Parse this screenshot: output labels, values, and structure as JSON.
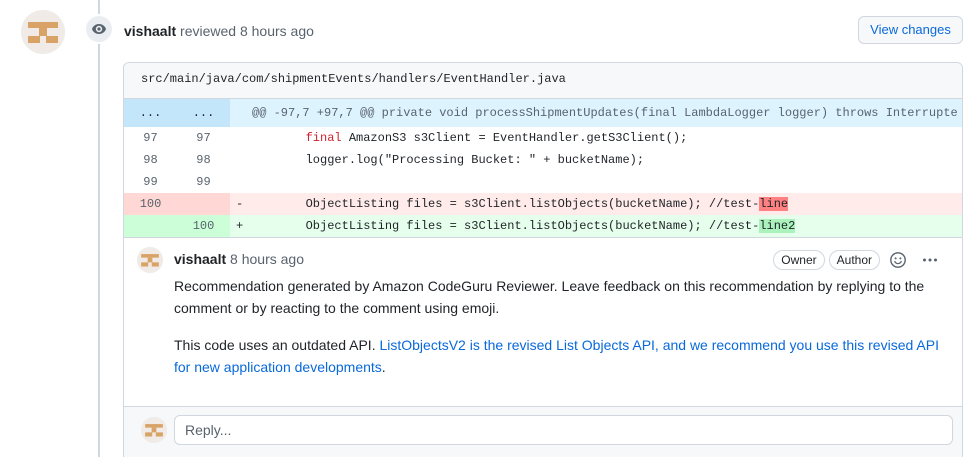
{
  "review": {
    "author": "vishaalt",
    "action": "reviewed",
    "time": "8 hours ago",
    "view_changes_label": "View changes"
  },
  "file": {
    "path": "src/main/java/com/shipmentEvents/handlers/EventHandler.java"
  },
  "diff": {
    "hunk": {
      "old_ln": "...",
      "new_ln": "...",
      "text": "@@ -97,7 +97,7 @@ private void processShipmentUpdates(final LambdaLogger logger) throws Interrupte"
    },
    "context_lines": [
      {
        "old_ln": "97",
        "new_ln": "97",
        "keyword": "final",
        "text": " AmazonS3 s3Client = EventHandler.getS3Client();"
      },
      {
        "old_ln": "98",
        "new_ln": "98",
        "keyword": "",
        "text": "logger.log(\"Processing Bucket: \" + bucketName);"
      },
      {
        "old_ln": "99",
        "new_ln": "99",
        "keyword": "",
        "text": ""
      }
    ],
    "deleted_line": {
      "old_ln": "100",
      "new_ln": "",
      "sign": "-",
      "text": "ObjectListing files = s3Client.listObjects(bucketName); //test-",
      "highlight": "line"
    },
    "added_line": {
      "old_ln": "",
      "new_ln": "100",
      "sign": "+",
      "text": "ObjectListing files = s3Client.listObjects(bucketName); //test-",
      "highlight": "line2"
    }
  },
  "comment": {
    "author": "vishaalt",
    "time": "8 hours ago",
    "labels": [
      "Owner",
      "Author"
    ],
    "paragraph1": "Recommendation generated by Amazon CodeGuru Reviewer. Leave feedback on this recommendation by replying to the comment or by reacting to the comment using emoji.",
    "paragraph2_prefix": "This code uses an outdated API. ",
    "paragraph2_link": "ListObjectsV2 is the revised List Objects API, and we recommend you use this revised API for new application developments",
    "paragraph2_suffix": "."
  },
  "reply": {
    "placeholder": "Reply..."
  },
  "icons": {
    "eye": "eye-icon",
    "smiley": "smiley-icon",
    "kebab": "kebab-horizontal-icon"
  },
  "colors": {
    "link": "#0969da",
    "hunk_bg": "#ddf4ff",
    "deleted_bg": "#ffebe9",
    "added_bg": "#e6ffec",
    "deleted_highlight": "#ff8182",
    "added_highlight": "#abf2bc"
  }
}
